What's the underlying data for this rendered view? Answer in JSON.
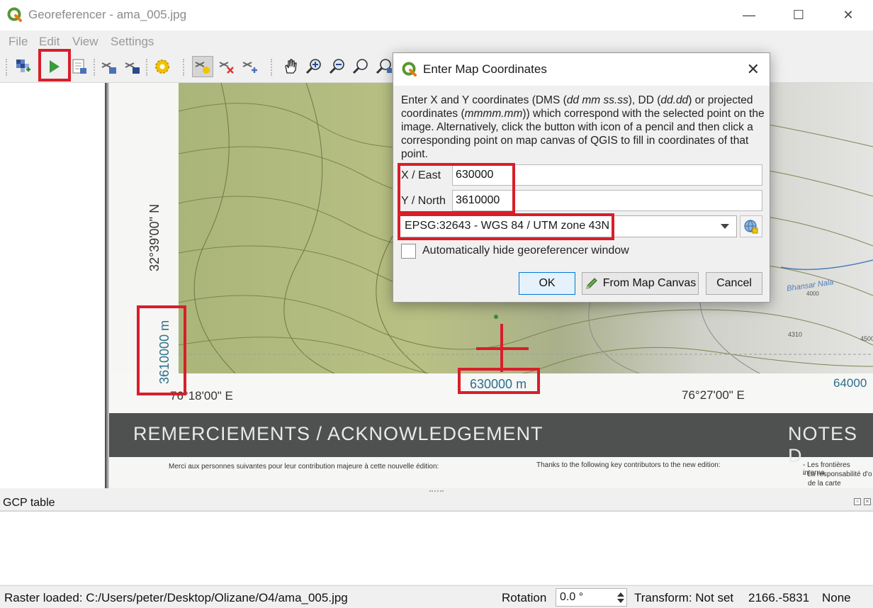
{
  "window": {
    "title": "Georeferencer - ama_005.jpg",
    "minimize": "—",
    "maximize": "☐",
    "close": "✕"
  },
  "menu": {
    "items": [
      "File",
      "Edit",
      "View",
      "Settings"
    ]
  },
  "toolbar": {
    "icons": [
      "open-raster-icon",
      "start-georeferencing-icon",
      "generate-gdal-script-icon",
      "load-gcp-points-icon",
      "save-gcp-points-icon",
      "transformation-settings-icon",
      "add-point-icon",
      "delete-point-icon",
      "move-gcp-point-icon",
      "pan-icon",
      "zoom-in-icon",
      "zoom-out-icon",
      "zoom-to-layer-icon",
      "zoom-last-icon"
    ]
  },
  "map": {
    "lat_label": "32°39'00\" N",
    "northing_label": "3610000 m",
    "lon_left": "76°18'00\" E",
    "easting_label": "630000 m",
    "lon_right": "76°27'00\" E",
    "easting_right": "64000",
    "river_label": "Bhansar Nala",
    "elev_1": "4000",
    "elev_2": "4310",
    "elev_3": "4500",
    "ack_title": "REMERCIEMENTS / ACKNOWLEDGEMENT",
    "notes_title": "NOTES D",
    "ack_fr": "Merci aux personnes suivantes pour leur contribution majeure à cette nouvelle édition:",
    "ack_en": "Thanks to the following key contributors to the new edition:",
    "notes_1": "- Les frontières interna",
    "notes_2": "- La responsabilité d'o",
    "notes_3": "de la carte"
  },
  "dialog": {
    "title": "Enter Map Coordinates",
    "close": "✕",
    "desc_1": "Enter X and Y coordinates (DMS (",
    "desc_dms": "dd mm ss.ss",
    "desc_2": "), DD (",
    "desc_dd": "dd.dd",
    "desc_3": ") or projected coordinates (",
    "desc_proj": "mmmm.mm",
    "desc_4": ")) which correspond with the selected point on the image. Alternatively, click the button with icon of a pencil and then click a corresponding point on map canvas of QGIS to fill in coordinates of that point.",
    "x_label": "X / East",
    "x_value": "630000",
    "y_label": "Y / North",
    "y_value": "3610000",
    "crs": "EPSG:32643 - WGS 84 / UTM zone 43N",
    "auto_hide_label": "Automatically hide georeferencer window",
    "ok": "OK",
    "from_canvas": "From Map Canvas",
    "cancel": "Cancel"
  },
  "gcp": {
    "title": "GCP table"
  },
  "status": {
    "raster": "Raster loaded: C:/Users/peter/Desktop/Olizane/O4/ama_005.jpg",
    "rotation_label": "Rotation",
    "rotation_value": "0.0 °",
    "transform": "Transform: Not set",
    "coords": "2166.-5831",
    "crs": "None"
  },
  "colors": {
    "annotation_red": "#d81e2a",
    "qgis_green": "#589632",
    "ok_border": "#0078d7"
  }
}
